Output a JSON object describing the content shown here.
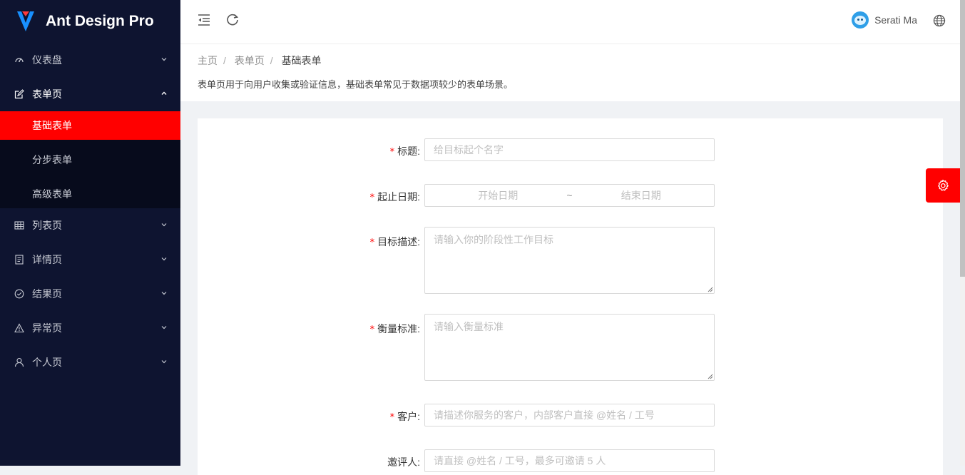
{
  "app": {
    "title": "Ant Design Pro",
    "brand_color": "#ff0000"
  },
  "sidebar": {
    "items": [
      {
        "label": "仪表盘",
        "icon": "dashboard-icon"
      },
      {
        "label": "表单页",
        "icon": "form-icon",
        "open": true,
        "children": [
          {
            "label": "基础表单",
            "active": true
          },
          {
            "label": "分步表单"
          },
          {
            "label": "高级表单"
          }
        ]
      },
      {
        "label": "列表页",
        "icon": "table-icon"
      },
      {
        "label": "详情页",
        "icon": "profile-icon"
      },
      {
        "label": "结果页",
        "icon": "check-circle-icon"
      },
      {
        "label": "异常页",
        "icon": "warning-icon"
      },
      {
        "label": "个人页",
        "icon": "user-icon"
      }
    ]
  },
  "header": {
    "user_name": "Serati Ma"
  },
  "breadcrumb": [
    "主页",
    "表单页",
    "基础表单"
  ],
  "page": {
    "description": "表单页用于向用户收集或验证信息，基础表单常见于数据项较少的表单场景。"
  },
  "form": {
    "title": {
      "label": "标题",
      "placeholder": "给目标起个名字"
    },
    "date": {
      "label": "起止日期",
      "start_placeholder": "开始日期",
      "end_placeholder": "结束日期",
      "separator": "~"
    },
    "goal": {
      "label": "目标描述",
      "placeholder": "请输入你的阶段性工作目标"
    },
    "standard": {
      "label": "衡量标准",
      "placeholder": "请输入衡量标准"
    },
    "client": {
      "label": "客户",
      "placeholder": "请描述你服务的客户，内部客户直接 @姓名 / 工号"
    },
    "invites": {
      "label": "邀评人",
      "placeholder": "请直接 @姓名 / 工号，最多可邀请 5 人"
    },
    "required_mark": "*",
    "colon": ":"
  }
}
